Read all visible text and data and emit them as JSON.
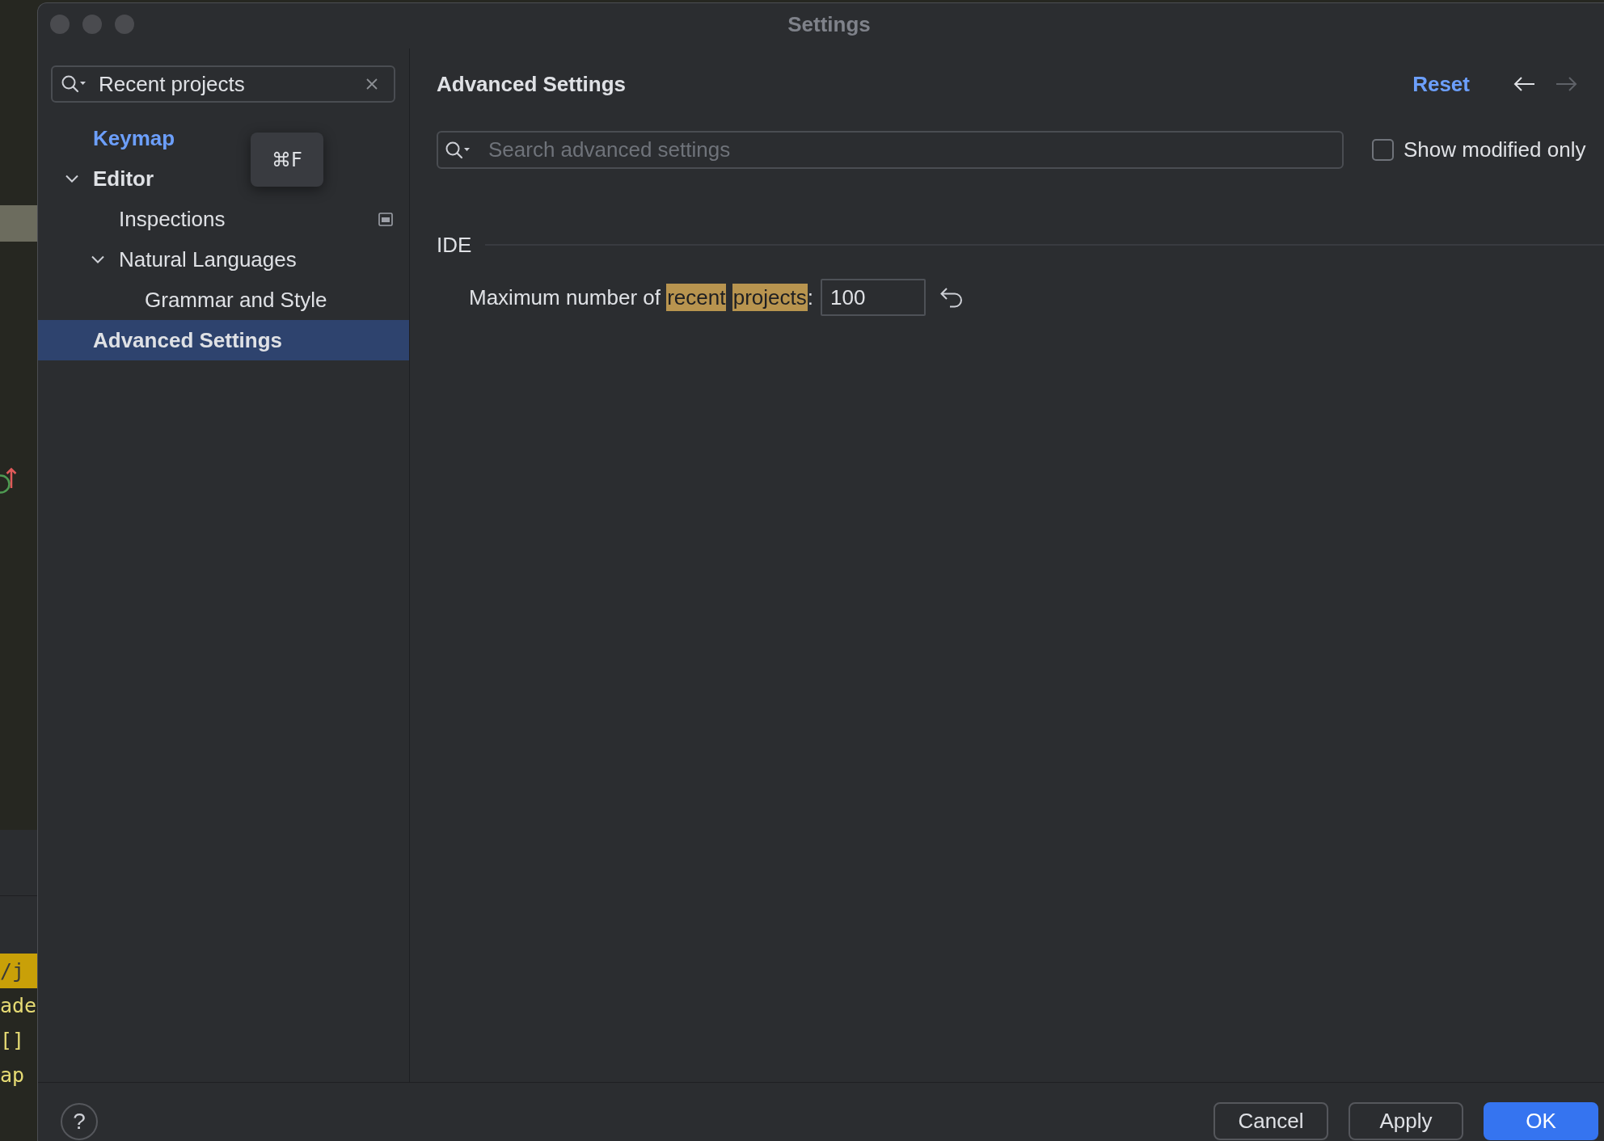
{
  "window": {
    "title": "Settings",
    "focused": false
  },
  "background_editor": {
    "code_lines": [
      {
        "text": "/j",
        "highlighted": true
      },
      {
        "text": "ade",
        "highlighted": false
      },
      {
        "text": "[]",
        "highlighted": false
      },
      {
        "text": "ap",
        "highlighted": false
      }
    ]
  },
  "sidebar": {
    "search": {
      "value": "Recent projects"
    },
    "tree": [
      {
        "label": "Keymap",
        "matched": true,
        "link": true,
        "selected": false,
        "has_icon": false
      },
      {
        "label": "Editor",
        "matched": true,
        "link": false,
        "selected": false,
        "has_icon": false,
        "expanded": true,
        "children": [
          {
            "label": "Inspections",
            "matched": false,
            "link": false,
            "selected": false,
            "has_icon": true
          },
          {
            "label": "Natural Languages",
            "matched": false,
            "link": false,
            "selected": false,
            "has_icon": false,
            "expanded": true,
            "children": [
              {
                "label": "Grammar and Style",
                "matched": false,
                "link": false,
                "selected": false,
                "has_icon": false
              }
            ]
          }
        ]
      },
      {
        "label": "Advanced Settings",
        "matched": true,
        "link": false,
        "selected": true,
        "has_icon": false
      }
    ]
  },
  "tooltip": {
    "text": "⌘F"
  },
  "main": {
    "title": "Advanced Settings",
    "reset_link": "Reset",
    "navigation": {
      "back_enabled": true,
      "forward_enabled": false
    },
    "search": {
      "placeholder": "Search advanced settings"
    },
    "show_modified_only": {
      "label": "Show modified only",
      "checked": false
    },
    "sections": [
      {
        "title": "IDE",
        "settings": [
          {
            "label_parts": [
              {
                "text": "Maximum number of ",
                "highlighted": false
              },
              {
                "text": "recent ",
                "highlighted": true
              },
              {
                "text": "projects",
                "highlighted": true
              },
              {
                "text": ":",
                "highlighted": false
              }
            ],
            "value": "100",
            "modified": true
          }
        ]
      }
    ]
  },
  "footer": {
    "help": "?",
    "buttons": [
      {
        "label": "Cancel",
        "kind": "secondary"
      },
      {
        "label": "Apply",
        "kind": "secondary"
      },
      {
        "label": "OK",
        "kind": "primary"
      }
    ]
  }
}
